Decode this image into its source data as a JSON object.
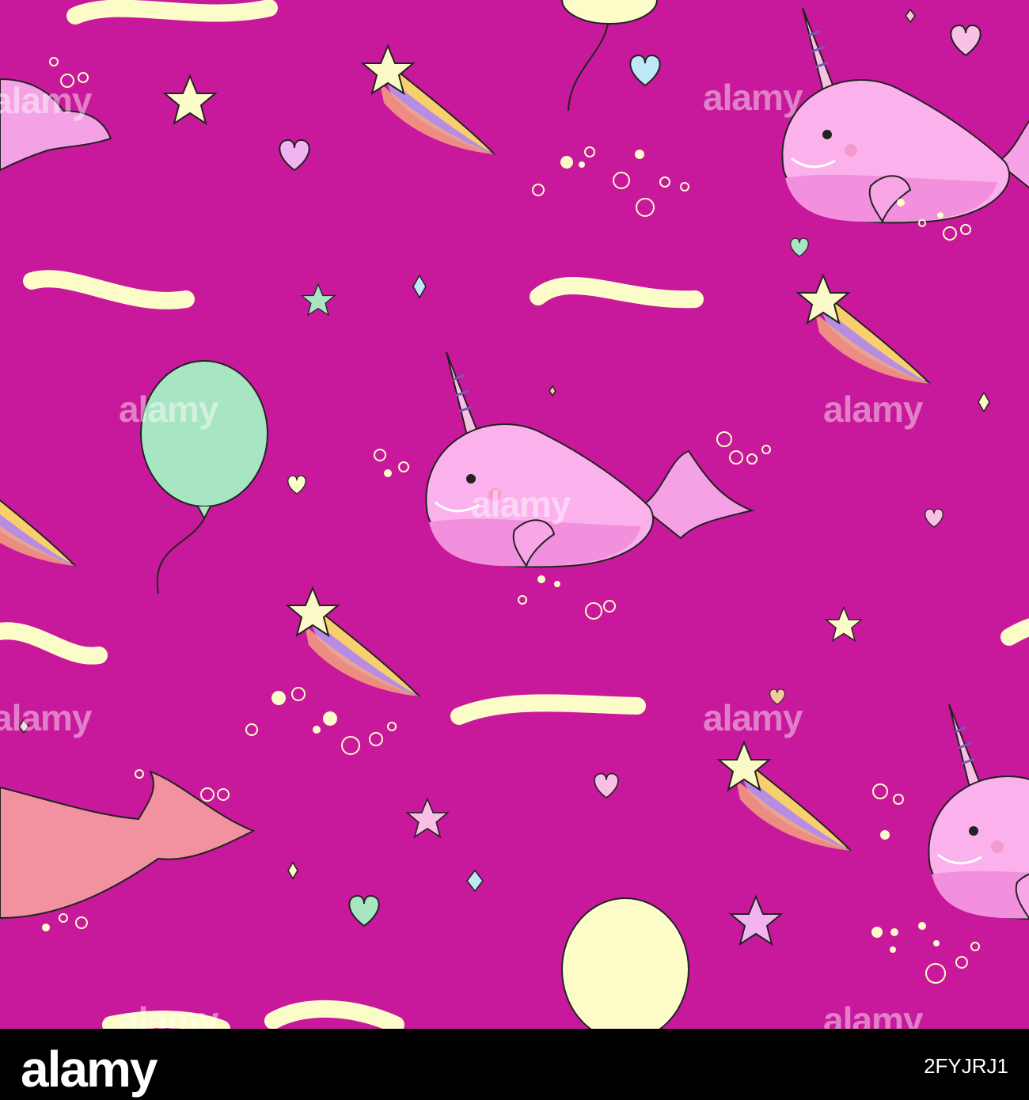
{
  "watermark": "alamy",
  "footer": {
    "brand": "alamy",
    "image_id": "2FYJRJ1"
  },
  "colors": {
    "background": "#c8199c",
    "footer": "#000000",
    "pink_narwhal": "#f4a1e6",
    "coral_narwhal": "#f2919f",
    "balloon_green": "#a8e6c3",
    "balloon_yellow": "#fbfcc8"
  }
}
